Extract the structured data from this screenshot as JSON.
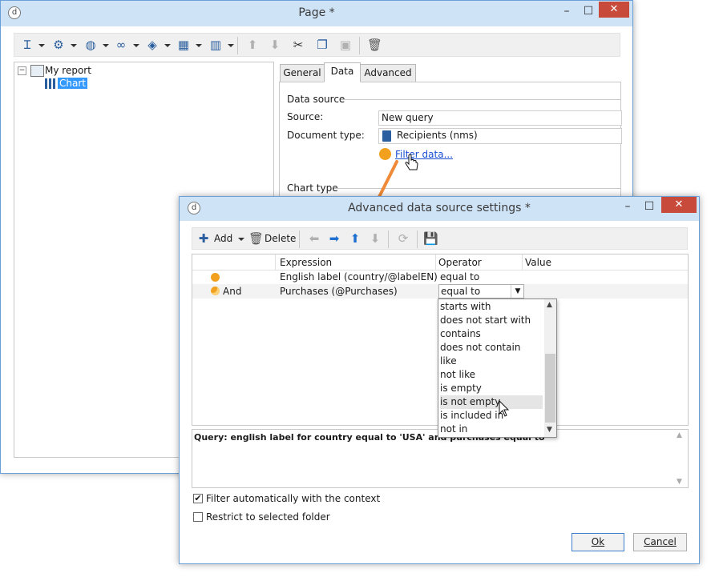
{
  "page_window": {
    "title": "Page *",
    "controls": {
      "minimize": "–",
      "maximize": "☐",
      "close": "✕"
    },
    "tree": {
      "root": "My report",
      "child": "Chart"
    },
    "tabs": [
      "General",
      "Data",
      "Advanced"
    ],
    "data_source": {
      "group_label": "Data source",
      "source_label": "Source:",
      "source_value": "New query",
      "doc_type_label": "Document type:",
      "doc_type_value": "Recipients (nms)",
      "filter_link": "Filter data..."
    },
    "chart_type_label": "Chart type"
  },
  "adv_window": {
    "title": "Advanced data source settings *",
    "controls": {
      "minimize": "–",
      "maximize": "☐",
      "close": "✕"
    },
    "toolbar": {
      "add": "Add",
      "delete": "Delete"
    },
    "columns": {
      "expression": "Expression",
      "operator": "Operator",
      "value": "Value"
    },
    "rows": [
      {
        "prefix": "",
        "expression": "English label (country/@labelEN)",
        "operator": "equal to"
      },
      {
        "prefix": "And",
        "expression": "Purchases (@Purchases)",
        "operator": "equal to"
      }
    ],
    "dropdown": {
      "options": [
        "starts with",
        "does not start with",
        "contains",
        "does not contain",
        "like",
        "not like",
        "is empty",
        "is not empty",
        "is included in",
        "not in"
      ],
      "hovered": "is not empty"
    },
    "query_text": "Query: english label for country equal to 'USA' and purchases equal to",
    "checkboxes": [
      {
        "label": "Filter automatically with the context",
        "checked": true
      },
      {
        "label": "Restrict to selected folder",
        "checked": false
      }
    ],
    "buttons": {
      "ok": "Ok",
      "cancel": "Cancel"
    }
  },
  "colors": {
    "titlebar": "#cfe3f7",
    "border": "#6a9fd8",
    "accent_orange": "#f2a11f",
    "close_red": "#c74a3a",
    "link": "#1a4fd1"
  }
}
